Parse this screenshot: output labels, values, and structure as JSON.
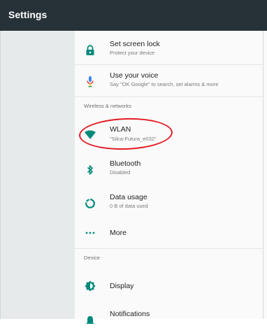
{
  "appbar": {
    "title": "Settings"
  },
  "sections": {
    "wireless": "Wireless & networks",
    "device": "Device"
  },
  "items": {
    "screen_lock": {
      "title": "Set screen lock",
      "subtitle": "Protect your device",
      "icon": "lock-icon"
    },
    "voice": {
      "title": "Use your voice",
      "subtitle": "Say \"OK Google\" to search, set alarms & more",
      "icon": "microphone-icon"
    },
    "wlan": {
      "title": "WLAN",
      "subtitle": "\"Silca-Futura_e032\"",
      "icon": "wifi-icon"
    },
    "bluetooth": {
      "title": "Bluetooth",
      "subtitle": "Disabled",
      "icon": "bluetooth-icon"
    },
    "data_usage": {
      "title": "Data usage",
      "subtitle": "0 B of data used",
      "icon": "data-usage-icon"
    },
    "more": {
      "title": "More",
      "icon": "more-dots-icon"
    },
    "display": {
      "title": "Display",
      "icon": "brightness-icon"
    },
    "notifications": {
      "title": "Notifications",
      "icon": "bell-icon"
    }
  },
  "colors": {
    "appbar": "#263238",
    "accent": "#00897b",
    "annotation": "#e31b23"
  }
}
